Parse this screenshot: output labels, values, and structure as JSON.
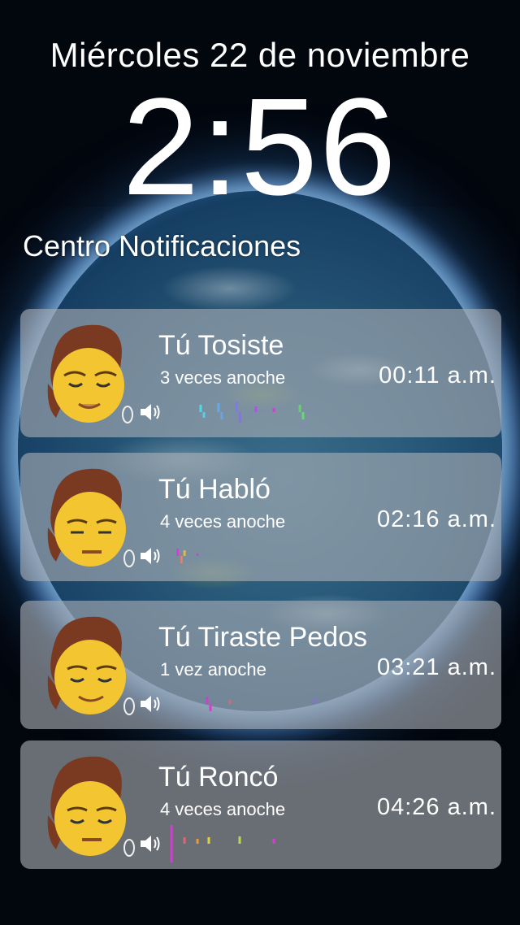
{
  "lockscreen": {
    "date": "Miércoles 22 de noviembre",
    "time": "2:56"
  },
  "notification_center": {
    "title": "Centro Notificaciones",
    "items": [
      {
        "title": "Tú Tosiste",
        "subtitle": "3 veces anoche",
        "time": "00:11 a.m.",
        "icon": "speaker-icon"
      },
      {
        "title": "Tú Habló",
        "subtitle": "4 veces anoche",
        "time": "02:16 a.m.",
        "icon": "speaker-icon"
      },
      {
        "title": "Tú Tiraste Pedos",
        "subtitle": "1 vez anoche",
        "time": "03:21 a.m.",
        "icon": "speaker-icon"
      },
      {
        "title": "Tú Roncó",
        "subtitle": "4 veces anoche",
        "time": "04:26 a.m.",
        "icon": "speaker-icon"
      }
    ]
  },
  "colors": {
    "card_bg": "#aaafb4",
    "text": "#ffffff",
    "wave_cyan": "#4fd8e8",
    "wave_magenta": "#d23cd6",
    "wave_yellow": "#e8d23c",
    "wave_green": "#5ee06a"
  }
}
